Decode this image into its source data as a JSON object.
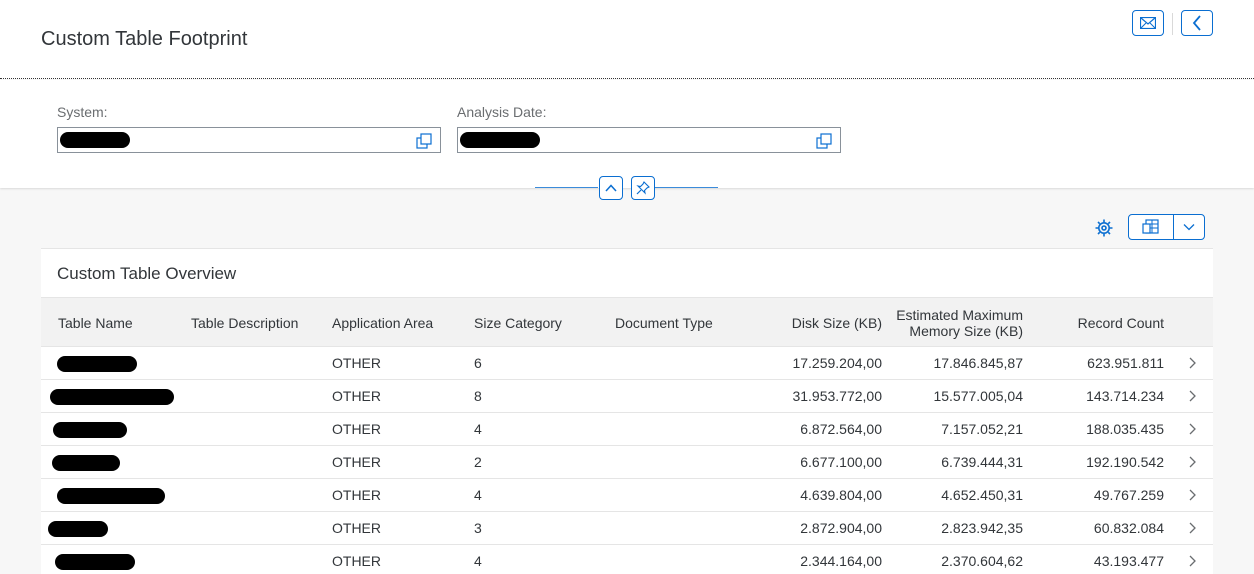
{
  "header": {
    "title": "Custom Table Footprint",
    "buttons": [
      "email-icon",
      "back-icon"
    ]
  },
  "filters": {
    "system_label": "System:",
    "analysis_date_label": "Analysis Date:",
    "system_value": "",
    "analysis_date_value": ""
  },
  "toolbar": {
    "settings_icon": "gear-icon",
    "export_icon": "spreadsheet-export-icon",
    "dropdown_icon": "chevron-down-icon"
  },
  "table": {
    "title": "Custom Table Overview",
    "columns": [
      "Table Name",
      "Table Description",
      "Application Area",
      "Size Category",
      "Document Type",
      "Disk Size (KB)",
      "Estimated Maximum Memory Size (KB)",
      "Record Count"
    ],
    "rows": [
      {
        "name": "",
        "description": "",
        "area": "OTHER",
        "size_category": "6",
        "doc_type": "",
        "disk_size": "17.259.204,00",
        "est_memory": "17.846.845,87",
        "record_count": "623.951.811"
      },
      {
        "name": "",
        "description": "",
        "area": "OTHER",
        "size_category": "8",
        "doc_type": "",
        "disk_size": "31.953.772,00",
        "est_memory": "15.577.005,04",
        "record_count": "143.714.234"
      },
      {
        "name": "",
        "description": "",
        "area": "OTHER",
        "size_category": "4",
        "doc_type": "",
        "disk_size": "6.872.564,00",
        "est_memory": "7.157.052,21",
        "record_count": "188.035.435"
      },
      {
        "name": "",
        "description": "",
        "area": "OTHER",
        "size_category": "2",
        "doc_type": "",
        "disk_size": "6.677.100,00",
        "est_memory": "6.739.444,31",
        "record_count": "192.190.542"
      },
      {
        "name": "",
        "description": "",
        "area": "OTHER",
        "size_category": "4",
        "doc_type": "",
        "disk_size": "4.639.804,00",
        "est_memory": "4.652.450,31",
        "record_count": "49.767.259"
      },
      {
        "name": "",
        "description": "",
        "area": "OTHER",
        "size_category": "3",
        "doc_type": "",
        "disk_size": "2.872.904,00",
        "est_memory": "2.823.942,35",
        "record_count": "60.832.084"
      },
      {
        "name": "",
        "description": "",
        "area": "OTHER",
        "size_category": "4",
        "doc_type": "",
        "disk_size": "2.344.164,00",
        "est_memory": "2.370.604,62",
        "record_count": "43.193.477"
      }
    ]
  },
  "colors": {
    "accent": "#0a6ed1",
    "text": "#32363a",
    "label": "#6a6d70",
    "background": "#f7f7f7"
  }
}
